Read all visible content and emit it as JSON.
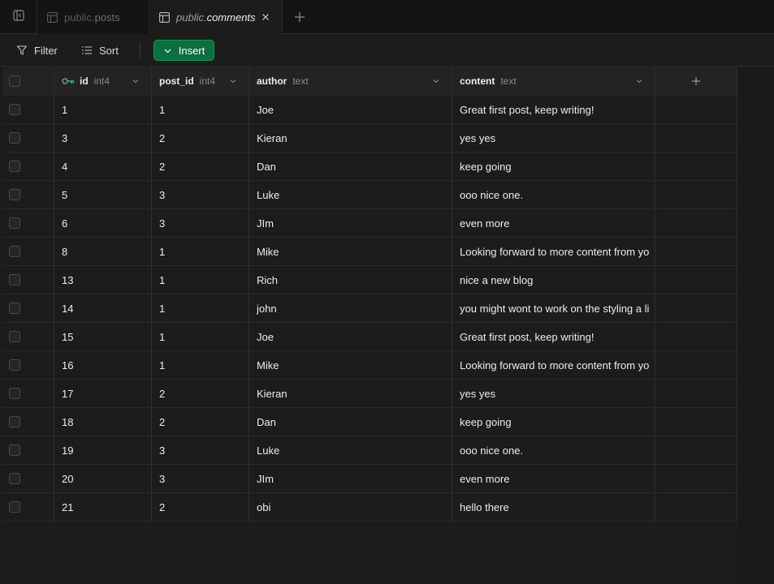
{
  "tabs": [
    {
      "schema": "public.",
      "name": "posts",
      "active": false
    },
    {
      "schema": "public.",
      "name": "comments",
      "active": true
    }
  ],
  "toolbar": {
    "filter_label": "Filter",
    "sort_label": "Sort",
    "insert_label": "Insert"
  },
  "columns": [
    {
      "name": "id",
      "type": "int4",
      "primary_key": true
    },
    {
      "name": "post_id",
      "type": "int4"
    },
    {
      "name": "author",
      "type": "text"
    },
    {
      "name": "content",
      "type": "text"
    }
  ],
  "rows": [
    {
      "id": "1",
      "post_id": "1",
      "author": "Joe",
      "content": "Great first post, keep writing!"
    },
    {
      "id": "3",
      "post_id": "2",
      "author": "Kieran",
      "content": "yes yes"
    },
    {
      "id": "4",
      "post_id": "2",
      "author": "Dan",
      "content": "keep going"
    },
    {
      "id": "5",
      "post_id": "3",
      "author": "Luke",
      "content": "ooo nice one."
    },
    {
      "id": "6",
      "post_id": "3",
      "author": "JIm",
      "content": "even more"
    },
    {
      "id": "8",
      "post_id": "1",
      "author": "Mike",
      "content": "Looking forward to more content from yo"
    },
    {
      "id": "13",
      "post_id": "1",
      "author": "Rich",
      "content": "nice a new blog"
    },
    {
      "id": "14",
      "post_id": "1",
      "author": "john",
      "content": "you might wont to work on the styling a li"
    },
    {
      "id": "15",
      "post_id": "1",
      "author": "Joe",
      "content": "Great first post, keep writing!"
    },
    {
      "id": "16",
      "post_id": "1",
      "author": "Mike",
      "content": "Looking forward to more content from yo"
    },
    {
      "id": "17",
      "post_id": "2",
      "author": "Kieran",
      "content": "yes yes"
    },
    {
      "id": "18",
      "post_id": "2",
      "author": "Dan",
      "content": "keep going"
    },
    {
      "id": "19",
      "post_id": "3",
      "author": "Luke",
      "content": "ooo nice one."
    },
    {
      "id": "20",
      "post_id": "3",
      "author": "JIm",
      "content": "even more"
    },
    {
      "id": "21",
      "post_id": "2",
      "author": "obi",
      "content": "hello there"
    }
  ],
  "colors": {
    "accent": "#0d6e3f",
    "key_icon": "#3ecf8e",
    "background": "#1c1c1c"
  },
  "icons": {
    "sidebar_toggle": "sidebar-toggle-icon",
    "table": "table-icon",
    "close": "close-icon",
    "new_tab": "plus-icon",
    "filter": "filter-icon",
    "sort": "sort-icon",
    "insert": "chevron-down-icon",
    "primary_key": "key-icon",
    "column_menu": "chevron-down-icon",
    "add_column": "plus-icon"
  }
}
